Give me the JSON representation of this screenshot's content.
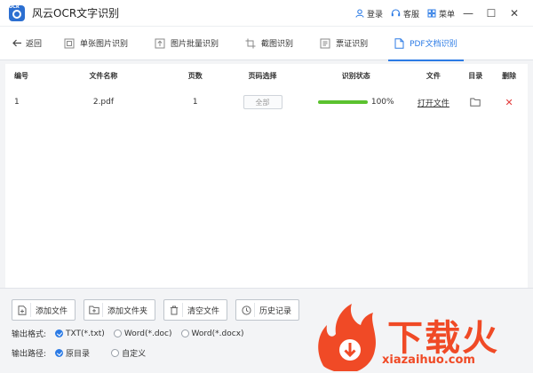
{
  "app": {
    "logo_tag": "OCR",
    "title": "风云OCR文字识别",
    "login": "登录",
    "service": "客服",
    "menu": "菜单"
  },
  "nav": {
    "back": "返回",
    "tabs": [
      "单张图片识别",
      "图片批量识别",
      "截图识别",
      "票证识别",
      "PDF文档识别"
    ],
    "active_tab": 4
  },
  "table": {
    "headers": [
      "编号",
      "文件名称",
      "页数",
      "页码选择",
      "识别状态",
      "文件",
      "目录",
      "删除"
    ],
    "rows": [
      {
        "id": "1",
        "name": "2.pdf",
        "pages": "1",
        "range": "全部",
        "progress_percent": 100,
        "progress_text": "100%",
        "file_action": "打开文件"
      }
    ]
  },
  "actions": {
    "add_file": "添加文件",
    "add_folder": "添加文件夹",
    "clear": "清空文件",
    "history": "历史记录"
  },
  "output": {
    "format_label": "输出格式:",
    "formats": [
      "TXT(*.txt)",
      "Word(*.doc)",
      "Word(*.docx)"
    ],
    "selected_format": 0,
    "path_label": "输出路径:",
    "paths": [
      "原目录",
      "自定义"
    ],
    "selected_path": 0
  },
  "watermark": {
    "brand": "下载火",
    "domain": "xiazaihuo.com"
  },
  "colors": {
    "accent": "#2c7be5",
    "progress": "#5bc22f",
    "delete": "#e23a3a",
    "watermark": "#f04a26"
  }
}
